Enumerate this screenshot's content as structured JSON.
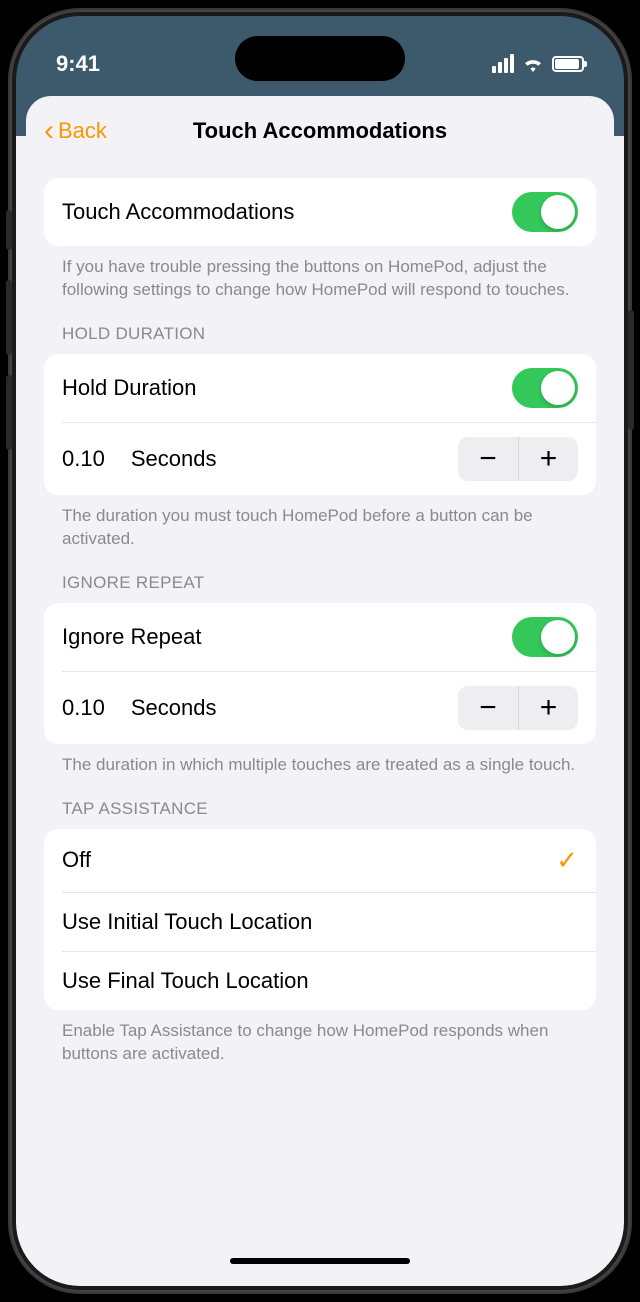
{
  "status": {
    "time": "9:41"
  },
  "nav": {
    "back_label": "Back",
    "title": "Touch Accommodations"
  },
  "main_toggle": {
    "label": "Touch Accommodations",
    "footer": "If you have trouble pressing the buttons on HomePod, adjust the following settings to change how HomePod will respond to touches."
  },
  "hold": {
    "header": "HOLD DURATION",
    "label": "Hold Duration",
    "value": "0.10",
    "unit": "Seconds",
    "footer": "The duration you must touch HomePod before a button can be activated."
  },
  "ignore": {
    "header": "IGNORE REPEAT",
    "label": "Ignore Repeat",
    "value": "0.10",
    "unit": "Seconds",
    "footer": "The duration in which multiple touches are treated as a single touch."
  },
  "tap": {
    "header": "TAP ASSISTANCE",
    "options": {
      "off": "Off",
      "initial": "Use Initial Touch Location",
      "final": "Use Final Touch Location"
    },
    "footer": "Enable Tap Assistance to change how HomePod responds when buttons are activated."
  }
}
